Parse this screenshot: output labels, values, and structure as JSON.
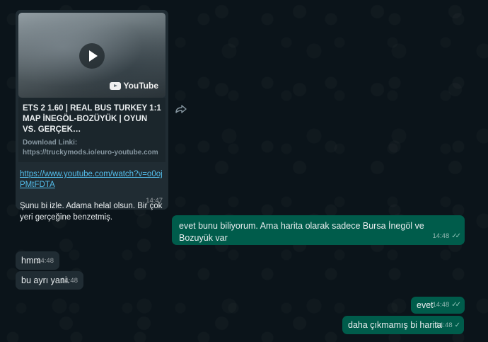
{
  "card": {
    "thumb_brand": "YouTube",
    "title": "ETS 2 1.60 | REAL BUS TURKEY 1:1 MAP İNEGÖL-BOZÜYÜK | OYUN VS. GERÇEK…",
    "desc": "Download Linki: https://truckymods.io/euro-youtube.com",
    "url": "https://www.youtube.com/watch?v=o0ojPMtFDTA",
    "text": "Şunu bi izle. Adama helal olsun. Bir çok yeri gerçeğine benzetmiş.",
    "time": "14:47"
  },
  "messages": [
    {
      "id": "m1",
      "dir": "out",
      "text": "evet bunu biliyorum. Ama harita olarak sadece Bursa İnegöl ve Bozuyük var",
      "time": "14:48",
      "ticks": "✓✓"
    },
    {
      "id": "m2",
      "dir": "in",
      "text": "hmm",
      "time": "14:48"
    },
    {
      "id": "m3",
      "dir": "in",
      "text": "bu ayrı yani.",
      "time": "14:48"
    },
    {
      "id": "m4",
      "dir": "out",
      "text": "evet",
      "time": "14:48",
      "ticks": "✓✓"
    },
    {
      "id": "m5",
      "dir": "out",
      "text": "daha çıkmamış bi harita",
      "time": "14:48",
      "ticks": "✓"
    }
  ]
}
